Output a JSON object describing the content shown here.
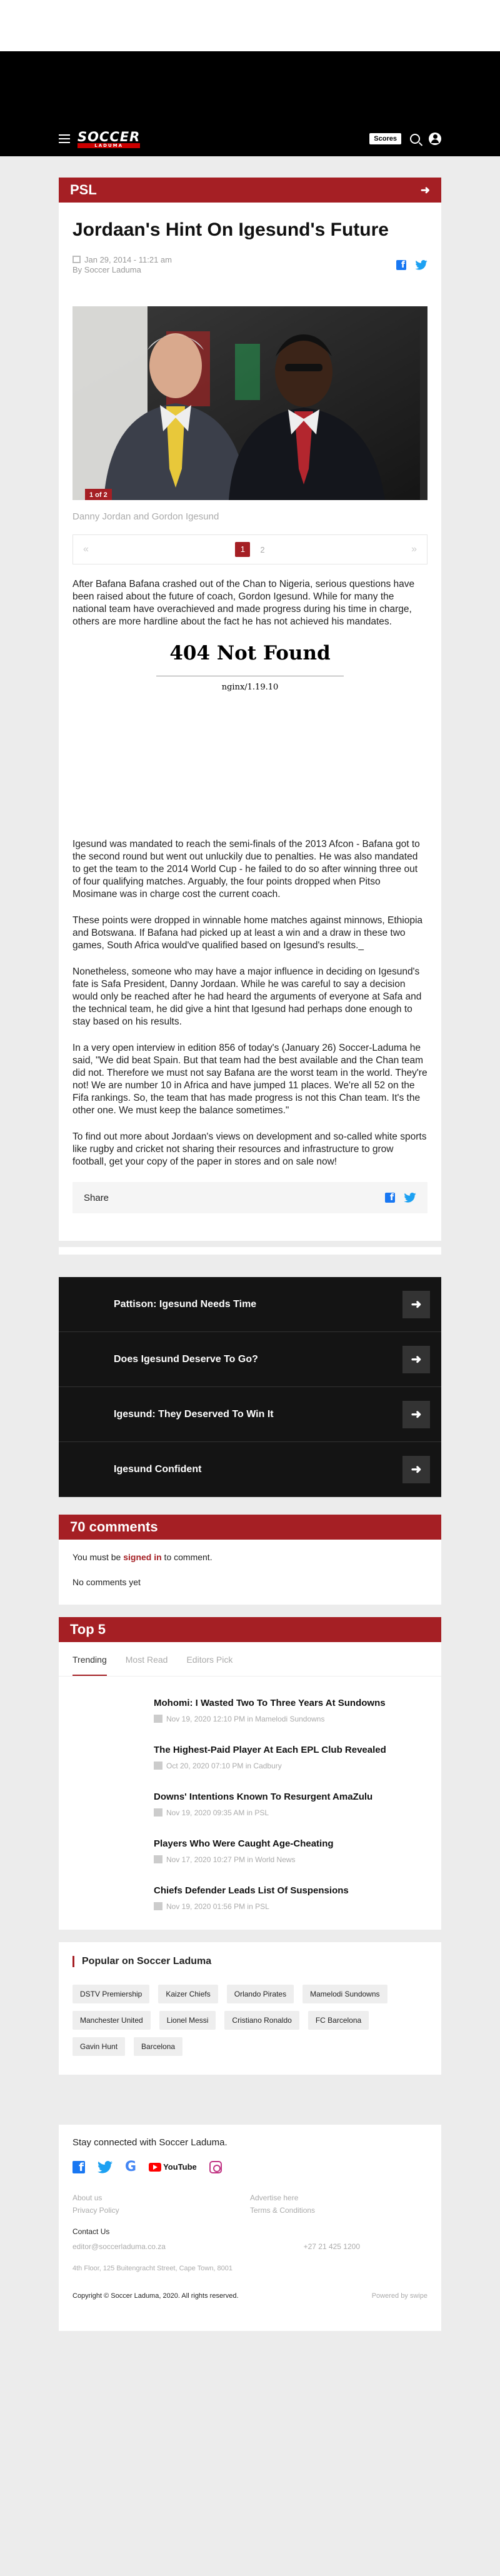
{
  "nav": {
    "logo_main": "SOCCER",
    "logo_sub": "LADUMA",
    "scores_label": "Scores"
  },
  "article": {
    "section": "PSL",
    "title": "Jordaan's Hint On Igesund's Future",
    "date": "Jan 29, 2014 - 11:21 am",
    "author": "By Soccer Laduma",
    "photo_badge": "1 of 2",
    "caption": "Danny Jordan and Gordon Igesund",
    "pager": {
      "prev": "«",
      "next": "»",
      "pages": [
        "1",
        "2"
      ]
    },
    "para1": "After Bafana Bafana crashed out of the Chan to Nigeria, serious questions have been raised about the future of coach, Gordon Igesund. While for many the national team have overachieved and made progress during his time in charge, others are more hardline about the fact he has not achieved his mandates.",
    "error_title": "404 Not Found",
    "error_server": "nginx/1.19.10",
    "paras": [
      "Igesund was mandated to reach the semi-finals of the 2013 Afcon - Bafana got to the second round but went out unluckily due to penalties. He was also mandated to get the team to the 2014 World Cup - he failed to do so after winning three out of four qualifying matches. Arguably, the four points dropped when Pitso Mosimane was in charge cost the current coach.",
      "These points were dropped in winnable home matches against minnows, Ethiopia and Botswana. If Bafana had picked up at least a win and a draw in these two games, South Africa would've qualified based on Igesund's results._",
      "Nonetheless, someone who may have a major influence in deciding on Igesund's fate is Safa President, Danny Jordaan. While he was careful to say a decision would only be reached after he had heard the arguments of everyone at Safa and the technical team, he did give a hint that Igesund had perhaps done enough to stay based on his results.",
      "In a very open interview in edition 856 of today's (January 26) Soccer-Laduma he said, \"We did beat Spain. But that team had the best available and the Chan team did not. Therefore we must not say Bafana are the worst team in the world. They're not! We are number 10 in Africa and have jumped 11 places. We're all 52 on the Fifa rankings. So, the team that has made progress is not this Chan team. It's the other one. We must keep the balance sometimes.\"",
      "To find out more about Jordaan's views on development and so-called white sports like rugby and cricket not sharing their resources and infrastructure to grow football, get your copy of the paper in stores and on sale now!"
    ],
    "share_label": "Share"
  },
  "related": [
    "Pattison: Igesund Needs Time",
    "Does Igesund Deserve To Go?",
    "Igesund: They Deserved To Win It",
    "Igesund Confident"
  ],
  "comments": {
    "title": "70 comments",
    "pre": "You must be ",
    "link": "signed in",
    "post": " to comment.",
    "none": "No comments yet"
  },
  "top5": {
    "title": "Top 5",
    "tabs": [
      "Trending",
      "Most Read",
      "Editors Pick"
    ],
    "stories": [
      {
        "title": "Mohomi: I Wasted Two To Three Years At Sundowns",
        "meta": "Nov 19, 2020 12:10 PM in Mamelodi Sundowns"
      },
      {
        "title": "The Highest-Paid Player At Each EPL Club Revealed",
        "meta": "Oct 20, 2020 07:10 PM in Cadbury"
      },
      {
        "title": "Downs' Intentions Known To Resurgent AmaZulu",
        "meta": "Nov 19, 2020 09:35 AM in PSL"
      },
      {
        "title": "Players Who Were Caught Age-Cheating",
        "meta": "Nov 17, 2020 10:27 PM in World News"
      },
      {
        "title": "Chiefs Defender Leads List Of Suspensions",
        "meta": "Nov 19, 2020 01:56 PM in PSL"
      }
    ]
  },
  "popular": {
    "title": "Popular on Soccer Laduma",
    "tags": [
      "DSTV Premiership",
      "Kaizer Chiefs",
      "Orlando Pirates",
      "Mamelodi Sundowns",
      "Manchester United",
      "Lionel Messi",
      "Cristiano Ronaldo",
      "FC Barcelona",
      "Gavin Hunt",
      "Barcelona"
    ]
  },
  "footer": {
    "stay": "Stay connected with Soccer Laduma.",
    "google": "G",
    "youtube": "YouTube",
    "links": [
      "About us",
      "Advertise here",
      "Privacy Policy",
      "Terms & Conditions"
    ],
    "contact_label": "Contact Us",
    "email": "editor@soccerladuma.co.za",
    "phone": "+27 21 425 1200",
    "address": "4th Floor, 125 Buitengracht Street, Cape Town, 8001",
    "copyright": "Copyright © Soccer Laduma, 2020. All rights reserved.",
    "powered": "Powered by swipe"
  }
}
